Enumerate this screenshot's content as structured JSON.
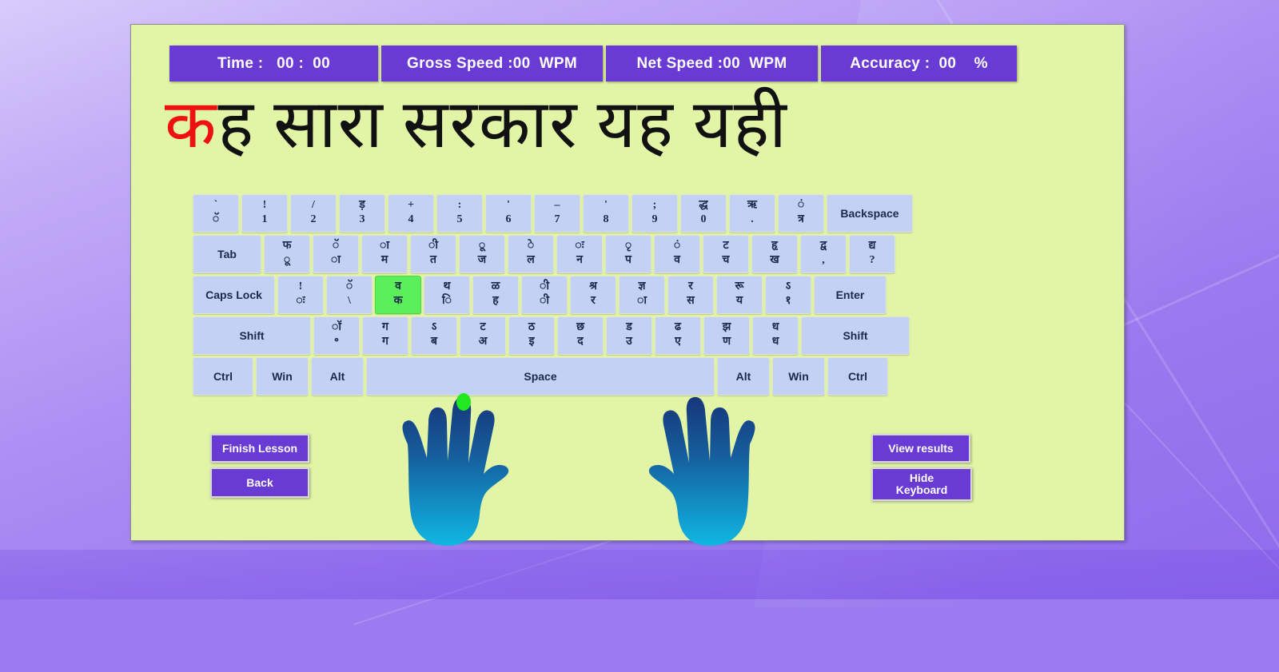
{
  "app": {
    "title": "Hindi Typing Tutor Lesson",
    "panel_bg": "#e2f5a6",
    "accent": "#6a3ad4",
    "key_bg": "#c3d2f4",
    "highlight": "#5bf05b",
    "current_char_color": "#ee1111"
  },
  "stats": [
    {
      "label": "Time :   00 :  00"
    },
    {
      "label": "Gross Speed :00  WPM"
    },
    {
      "label": "Net Speed :00  WPM"
    },
    {
      "label": "Accuracy :  00    %"
    }
  ],
  "practice": {
    "current_char": "क",
    "remaining": "ह सारा सरकार यह यही",
    "full_text": "कह सारा सरकार यह यही"
  },
  "keyboard": {
    "highlighted_key": "व / क",
    "rows": [
      [
        {
          "type": "dual",
          "up": "`",
          "lo": "ॅ",
          "width": "u"
        },
        {
          "type": "dual",
          "up": "!",
          "lo": "1",
          "width": "u"
        },
        {
          "type": "dual",
          "up": "/",
          "lo": "2",
          "width": "u"
        },
        {
          "type": "dual",
          "up": "ड़",
          "lo": "3",
          "width": "u"
        },
        {
          "type": "dual",
          "up": "+",
          "lo": "4",
          "width": "u"
        },
        {
          "type": "dual",
          "up": ":",
          "lo": "5",
          "width": "u"
        },
        {
          "type": "dual",
          "up": "'",
          "lo": "6",
          "width": "u"
        },
        {
          "type": "dual",
          "up": "–",
          "lo": "7",
          "width": "u"
        },
        {
          "type": "dual",
          "up": "'",
          "lo": "8",
          "width": "u"
        },
        {
          "type": "dual",
          "up": ";",
          "lo": "9",
          "width": "u"
        },
        {
          "type": "dual",
          "up": "द्ध",
          "lo": "0",
          "width": "u"
        },
        {
          "type": "dual",
          "up": "ऋ",
          "lo": ".",
          "width": "u"
        },
        {
          "type": "dual",
          "up": "ं",
          "lo": "त्र",
          "width": "u"
        },
        {
          "type": "label",
          "label": "Backspace",
          "width": "k-bksp"
        }
      ],
      [
        {
          "type": "label",
          "label": "Tab",
          "width": "k-tab"
        },
        {
          "type": "dual",
          "up": "फ",
          "lo": "ू",
          "width": "u"
        },
        {
          "type": "dual",
          "up": "ॅ",
          "lo": "ा",
          "width": "u"
        },
        {
          "type": "dual",
          "up": "ा",
          "lo": "म",
          "width": "u"
        },
        {
          "type": "dual",
          "up": "ी",
          "lo": "त",
          "width": "u"
        },
        {
          "type": "dual",
          "up": "ू",
          "lo": "ज",
          "width": "u"
        },
        {
          "type": "dual",
          "up": "े",
          "lo": "ल",
          "width": "u"
        },
        {
          "type": "dual",
          "up": "ः",
          "lo": "न",
          "width": "u"
        },
        {
          "type": "dual",
          "up": "ृ",
          "lo": "प",
          "width": "u"
        },
        {
          "type": "dual",
          "up": "ं",
          "lo": "व",
          "width": "u"
        },
        {
          "type": "dual",
          "up": "ट",
          "lo": "च",
          "width": "u"
        },
        {
          "type": "dual",
          "up": "हृ",
          "lo": "ख",
          "width": "u"
        },
        {
          "type": "dual",
          "up": "द्व",
          "lo": ",",
          "width": "u"
        },
        {
          "type": "dual",
          "up": "द्य",
          "lo": "?",
          "width": "u"
        }
      ],
      [
        {
          "type": "label",
          "label": "Caps Lock",
          "width": "k-caps"
        },
        {
          "type": "dual",
          "up": "!",
          "lo": "ः",
          "width": "u"
        },
        {
          "type": "dual",
          "up": "ॅ",
          "lo": "\\",
          "width": "u"
        },
        {
          "type": "dual",
          "up": "व",
          "lo": "क",
          "width": "u",
          "highlight": true
        },
        {
          "type": "dual",
          "up": "थ",
          "lo": "ि",
          "width": "u"
        },
        {
          "type": "dual",
          "up": "ळ",
          "lo": "ह",
          "width": "u"
        },
        {
          "type": "dual",
          "up": "ी",
          "lo": "ी",
          "width": "u"
        },
        {
          "type": "dual",
          "up": "श्र",
          "lo": "र",
          "width": "u"
        },
        {
          "type": "dual",
          "up": "ज्ञ",
          "lo": "ा",
          "width": "u"
        },
        {
          "type": "dual",
          "up": "र",
          "lo": "स",
          "width": "u"
        },
        {
          "type": "dual",
          "up": "रू",
          "lo": "य",
          "width": "u"
        },
        {
          "type": "dual",
          "up": "ऽ",
          "lo": "१",
          "width": "u"
        },
        {
          "type": "label",
          "label": "Enter",
          "width": "k-enter"
        }
      ],
      [
        {
          "type": "label",
          "label": "Shift",
          "width": "k-shiftl"
        },
        {
          "type": "dual",
          "up": "ॉ",
          "lo": "॰",
          "width": "u"
        },
        {
          "type": "dual",
          "up": "ग",
          "lo": "ग",
          "width": "u"
        },
        {
          "type": "dual",
          "up": "ऽ",
          "lo": "ब",
          "width": "u"
        },
        {
          "type": "dual",
          "up": "ट",
          "lo": "अ",
          "width": "u"
        },
        {
          "type": "dual",
          "up": "ठ",
          "lo": "इ",
          "width": "u"
        },
        {
          "type": "dual",
          "up": "छ",
          "lo": "द",
          "width": "u"
        },
        {
          "type": "dual",
          "up": "ड",
          "lo": "उ",
          "width": "u"
        },
        {
          "type": "dual",
          "up": "ढ",
          "lo": "ए",
          "width": "u"
        },
        {
          "type": "dual",
          "up": "झ",
          "lo": "ण",
          "width": "u"
        },
        {
          "type": "dual",
          "up": "ध",
          "lo": "ध",
          "width": "u"
        },
        {
          "type": "label",
          "label": "Shift",
          "width": "k-shiftr"
        }
      ],
      [
        {
          "type": "label",
          "label": "Ctrl",
          "width": "k-ctrl"
        },
        {
          "type": "label",
          "label": "Win",
          "width": "k-win"
        },
        {
          "type": "label",
          "label": "Alt",
          "width": "k-alt"
        },
        {
          "type": "label",
          "label": "Space",
          "width": "k-space"
        },
        {
          "type": "label",
          "label": "Alt",
          "width": "k-alt"
        },
        {
          "type": "label",
          "label": "Win",
          "width": "k-win"
        },
        {
          "type": "label",
          "label": "Ctrl",
          "width": "k-ctrl"
        }
      ]
    ]
  },
  "hands": {
    "active_finger": "left-middle",
    "marker_color": "#22e822",
    "gradient_top": "#173a7a",
    "gradient_bottom": "#12b5e0"
  },
  "buttons": {
    "finish_lesson": "Finish Lesson",
    "back": "Back",
    "view_results": "View results",
    "hide_keyboard": "Hide\nKeyboard"
  }
}
